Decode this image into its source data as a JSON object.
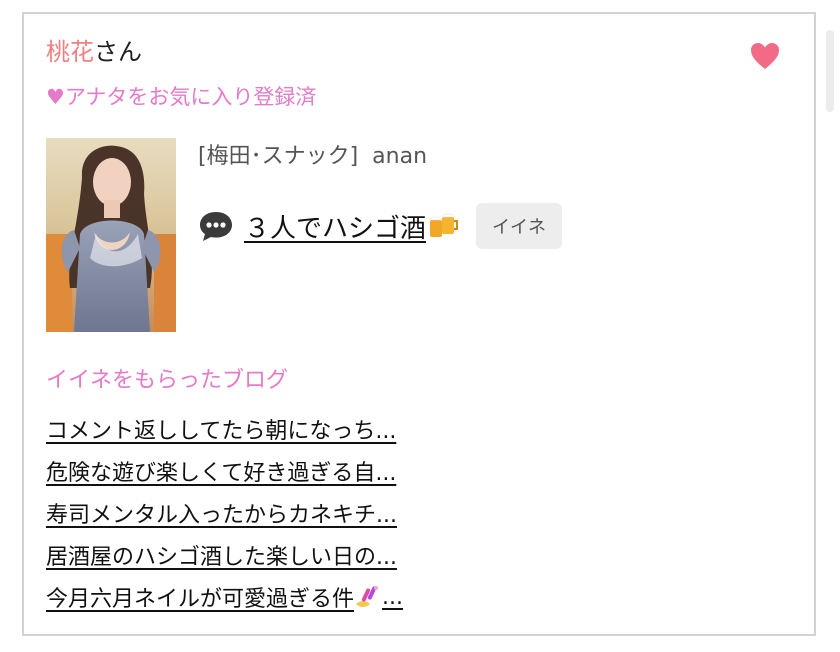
{
  "profile": {
    "name": "桃花",
    "suffix": "さん",
    "favorite_status": "♥アナタをお気に入り登録済",
    "shop": "[梅田･スナック]",
    "handle": "anan"
  },
  "post": {
    "title": "３人でハシゴ酒",
    "like_button": "イイネ"
  },
  "blogs": {
    "heading": "イイネをもらったブログ",
    "items": [
      "コメント返ししてたら朝になっち...",
      "危険な遊び楽しくて好き過ぎる自...",
      "寿司メンタル入ったからカネキチ...",
      "居酒屋のハシゴ酒した楽しい日の...",
      "今月六月ネイルが可愛過ぎる件"
    ],
    "last_suffix": "..."
  },
  "icons": {
    "heart": "heart-icon",
    "chat": "speech-bubble-icon",
    "beer": "beer-mugs-icon",
    "nail": "nail-polish-icon"
  },
  "colors": {
    "name": "#f08080",
    "accent_pink": "#e57ac8",
    "heart": "#f26b86"
  }
}
